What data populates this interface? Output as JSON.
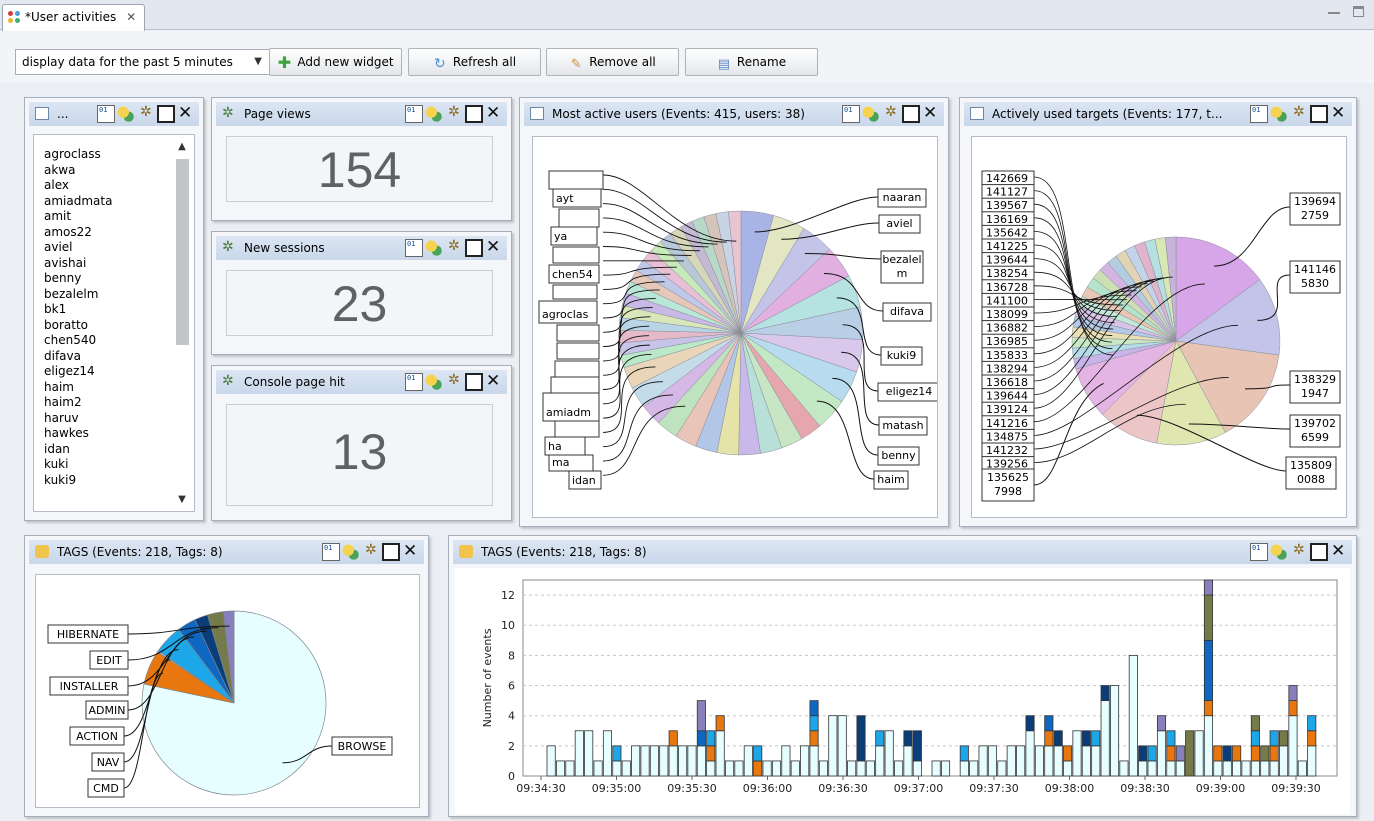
{
  "tab": {
    "title": "*User activities"
  },
  "toolbar": {
    "time_range": "display data for the past 5 minutes",
    "add_widget": "Add new widget",
    "refresh_all": "Refresh all",
    "remove_all": "Remove all",
    "rename": "Rename"
  },
  "users_widget": {
    "title": "...",
    "users": [
      "agroclass",
      "akwa",
      "alex",
      "amiadmata",
      "amit",
      "amos22",
      "aviel",
      "avishai",
      "benny",
      "bezalelm",
      "bk1",
      "boratto",
      "chen540",
      "difava",
      "eligez14",
      "haim",
      "haim2",
      "haruv",
      "hawkes",
      "idan",
      "kuki",
      "kuki9"
    ]
  },
  "page_views": {
    "title": "Page views",
    "value": "154"
  },
  "new_sessions": {
    "title": "New sessions",
    "value": "23"
  },
  "console_hit": {
    "title": "Console page hit",
    "value": "13"
  },
  "active_users": {
    "title": "Most active users  (Events: 415, users: 38)",
    "visible_labels": [
      "naaran",
      "aviel",
      "bezalel m",
      "difava",
      "kuki9",
      "eligez14",
      "matash",
      "benny",
      "haim",
      "ayt",
      "ya",
      "chen54",
      "agroclas",
      "amiadm",
      "idan",
      "ma",
      "ha"
    ],
    "colors": [
      "#a8b4e6",
      "#e3e6c3",
      "#c4c4e8",
      "#e2b0e0",
      "#b7e2e2",
      "#b9cfe6",
      "#d9c8ec",
      "#b7dcef",
      "#c3e9c4",
      "#e6a6ae",
      "#c8e6c3",
      "#b8e0d8",
      "#c9b8ea",
      "#e6e3a8",
      "#b2c6e8",
      "#e9c4b9",
      "#bfe3bf",
      "#d6b8e6",
      "#c4dce9",
      "#e9d6b9",
      "#b9e9c8",
      "#c8c4e9",
      "#e6b9c8",
      "#b9d4e6",
      "#d9e6b9",
      "#c8b9e6",
      "#b9e6d6",
      "#e6c8b9",
      "#bfc8e9",
      "#e9bfd6",
      "#c8e9b9",
      "#b9c8d9",
      "#d6d6b9",
      "#c4b9d4",
      "#b9d9c8",
      "#d4c4b9",
      "#c8d4e6",
      "#e6c4d4"
    ]
  },
  "targets": {
    "title": "Actively used targets  (Events: 177, t...",
    "slices": [
      {
        "label": "139694 2759",
        "color": "#d6a6e8"
      },
      {
        "label": "141146 5830",
        "color": "#c4c4ea"
      },
      {
        "label": "138329 1947",
        "color": "#e8c4b4"
      },
      {
        "label": "139702 6599",
        "color": "#dfe6b0"
      },
      {
        "label": "135809 0088",
        "color": "#ecc6c6"
      },
      {
        "label": "135625 7998",
        "color": "#e4b4e4"
      }
    ],
    "small_colors": [
      "#c9b4ea",
      "#b4dce8",
      "#c8e8c4",
      "#e8e0b4",
      "#b4c8e8",
      "#d8c4e8",
      "#c4e8d8",
      "#e8c8b4",
      "#b4e4cc",
      "#cce0b4",
      "#d4b4e0",
      "#b4cce0",
      "#e0d4b4",
      "#c4d4e8",
      "#e0b4cc",
      "#b4e0e0",
      "#d8e8b4",
      "#c8b4d8"
    ],
    "left_labels": [
      "142669",
      "141127",
      "139567",
      "136169",
      "135642",
      "141225",
      "139644",
      "138254",
      "136728",
      "141100",
      "138099",
      "136882",
      "136985",
      "135833",
      "138294",
      "136618",
      "139644",
      "139124",
      "141216",
      "134875",
      "141232",
      "139256"
    ]
  },
  "tags_pie": {
    "title": "TAGS  (Events: 218, Tags: 8)",
    "slices": [
      {
        "label": "BROWSE",
        "value": 168,
        "color": "#e6feff"
      },
      {
        "label": "CMD",
        "value": 13,
        "color": "#e8770f"
      },
      {
        "label": "NAV",
        "value": 0.5,
        "color": "#c8e6ef"
      },
      {
        "label": "ACTION",
        "value": 11,
        "color": "#1da6e8"
      },
      {
        "label": "ADMIN",
        "value": 7,
        "color": "#0e68c2"
      },
      {
        "label": "INSTALLER",
        "value": 5,
        "color": "#0b3d78"
      },
      {
        "label": "EDIT",
        "value": 6,
        "color": "#747a4a"
      },
      {
        "label": "HIBERNATE",
        "value": 4,
        "color": "#8880bc"
      }
    ]
  },
  "tags_bars": {
    "title": "TAGS  (Events: 218, Tags: 8)",
    "chart_data": {
      "type": "bar",
      "stacked": true,
      "ylabel": "Number of events",
      "ylim": [
        0,
        13
      ],
      "yticks": [
        0,
        2,
        4,
        6,
        8,
        10,
        12
      ],
      "xticks": [
        "09:34:30",
        "09:35:00",
        "09:35:30",
        "09:36:00",
        "09:36:30",
        "09:37:00",
        "09:37:30",
        "09:38:00",
        "09:38:30",
        "09:39:00",
        "09:39:30"
      ],
      "series_colors": [
        "#e6feff",
        "#e8770f",
        "#1da6e8",
        "#0e68c2",
        "#0b3d78",
        "#747a4a",
        "#8880bc"
      ],
      "bars": [
        {
          "b": 2
        },
        {
          "b": 1
        },
        {
          "b": 1
        },
        {
          "b": 3
        },
        {
          "b": 3
        },
        {
          "b": 1
        },
        {
          "b": 3
        },
        {
          "b": 1,
          "c": 1
        },
        {
          "b": 1
        },
        {
          "b": 2
        },
        {
          "b": 2
        },
        {
          "b": 2
        },
        {
          "b": 2
        },
        {
          "b": 2,
          "a": 1
        },
        {
          "b": 2
        },
        {
          "b": 2
        },
        {
          "b": 2,
          "d": 1,
          "h": 2
        },
        {
          "b": 1,
          "c": 1,
          "a": 1
        },
        {
          "b": 3,
          "a": 1
        },
        {
          "b": 1
        },
        {
          "b": 1
        },
        {
          "b": 2
        },
        {
          "b": 0,
          "c": 1,
          "a": 1
        },
        {
          "b": 1
        },
        {
          "b": 1
        },
        {
          "b": 2
        },
        {
          "b": 1
        },
        {
          "b": 2
        },
        {
          "b": 2,
          "c": 1,
          "d": 1,
          "a": 1
        },
        {
          "b": 1
        },
        {
          "b": 4
        },
        {
          "b": 4
        },
        {
          "b": 1
        },
        {
          "b": 1,
          "e": 3
        },
        {
          "b": 1
        },
        {
          "b": 2,
          "c": 1
        },
        {
          "b": 3
        },
        {
          "b": 1
        },
        {
          "b": 2,
          "e": 1
        },
        {
          "b": 1,
          "e": 2
        },
        {
          "b": 0
        },
        {
          "b": 1
        },
        {
          "b": 1
        },
        {
          "b": 0
        },
        {
          "b": 1,
          "c": 1
        },
        {
          "b": 1
        },
        {
          "b": 2
        },
        {
          "b": 2
        },
        {
          "b": 1
        },
        {
          "b": 2
        },
        {
          "b": 2
        },
        {
          "b": 3,
          "e": 1
        },
        {
          "b": 2
        },
        {
          "b": 2,
          "a": 1,
          "d": 1
        },
        {
          "b": 2,
          "e": 1
        },
        {
          "b": 1,
          "a": 1
        },
        {
          "b": 3
        },
        {
          "b": 2,
          "e": 1
        },
        {
          "b": 2,
          "c": 1
        },
        {
          "b": 5,
          "e": 1
        },
        {
          "b": 6
        },
        {
          "b": 1
        },
        {
          "b": 8
        },
        {
          "b": 1,
          "e": 1
        },
        {
          "b": 1,
          "c": 1
        },
        {
          "b": 3,
          "h": 1
        },
        {
          "b": 1,
          "a": 1,
          "c": 1
        },
        {
          "b": 1,
          "h": 1
        },
        {
          "b": 0,
          "f": 3
        },
        {
          "b": 3
        },
        {
          "b": 4,
          "a": 1,
          "d": 4,
          "f": 3,
          "h": 1
        },
        {
          "b": 1,
          "a": 1
        },
        {
          "b": 1,
          "e": 1
        },
        {
          "b": 1,
          "a": 1
        },
        {
          "b": 1
        },
        {
          "b": 1,
          "f": 1,
          "a": 1,
          "c": 1
        },
        {
          "b": 1,
          "f": 1
        },
        {
          "b": 1,
          "a": 1,
          "c": 1
        },
        {
          "b": 2,
          "f": 1
        },
        {
          "b": 4,
          "a": 1,
          "h": 1
        },
        {
          "b": 1
        },
        {
          "b": 2,
          "a": 1,
          "c": 1
        }
      ]
    }
  }
}
